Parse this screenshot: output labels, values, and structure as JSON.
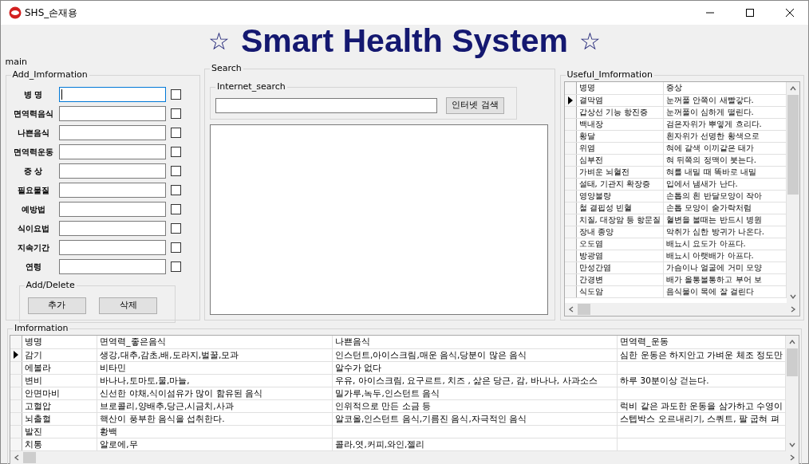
{
  "window": {
    "title": "SHS_손재용"
  },
  "header": {
    "left_star": "☆",
    "title": "Smart Health System",
    "right_star": "☆"
  },
  "main_label": "main",
  "add_information": {
    "title": "Add_Imformation",
    "fields": [
      {
        "label": "병 명",
        "focused": true,
        "checked": false
      },
      {
        "label": "면역력음식",
        "focused": false,
        "checked": false
      },
      {
        "label": "나쁜음식",
        "focused": false,
        "checked": false
      },
      {
        "label": "면역력운동",
        "focused": false,
        "checked": false
      },
      {
        "label": "증 상",
        "focused": false,
        "checked": false
      },
      {
        "label": "필요물질",
        "focused": false,
        "checked": false
      },
      {
        "label": "예방법",
        "focused": false,
        "checked": false
      },
      {
        "label": "식이요법",
        "focused": false,
        "checked": false
      },
      {
        "label": "지속기간",
        "focused": false,
        "checked": false
      },
      {
        "label": "연령",
        "focused": false,
        "checked": false
      }
    ],
    "add_delete": {
      "title": "Add/Delete",
      "buttons": [
        "추가",
        "삭제"
      ]
    }
  },
  "search": {
    "title": "Search",
    "internet_search": {
      "title": "Internet_search",
      "button": "인터넷 검색"
    }
  },
  "useful_information": {
    "title": "Useful_Imformation",
    "columns": [
      "병명",
      "증상"
    ],
    "rows": [
      {
        "cells": [
          "결막염",
          "눈꺼풀 안쪽이 새빨갛다."
        ],
        "selected": true
      },
      {
        "cells": [
          "갑상선 기능 항진증",
          "눈꺼풀이 심하게 떨린다."
        ],
        "selected": false
      },
      {
        "cells": [
          "백내장",
          "검은자위가 뿌옇게 흐리다."
        ],
        "selected": false
      },
      {
        "cells": [
          "황달",
          "흰자위가 선명한 황색으로"
        ],
        "selected": false
      },
      {
        "cells": [
          "위염",
          "혀에 갈색 이끼같은 태가"
        ],
        "selected": false
      },
      {
        "cells": [
          "심부전",
          "혀 뒤쪽의 정맥이 붓는다."
        ],
        "selected": false
      },
      {
        "cells": [
          "가벼운 뇌혈전",
          "혀를 내밀 때 똑바로 내밀"
        ],
        "selected": false
      },
      {
        "cells": [
          "설태, 기관지 확장증",
          "입에서 냄새가 난다."
        ],
        "selected": false
      },
      {
        "cells": [
          "영양불량",
          "손톱의 흰 반달모양이 작아"
        ],
        "selected": false
      },
      {
        "cells": [
          "철 결핍성 빈혈",
          "손톱 모양이 숟가락처럼"
        ],
        "selected": false
      },
      {
        "cells": [
          "치질, 대장암 등 항문질",
          "혈변을 볼때는 반드시 병원"
        ],
        "selected": false
      },
      {
        "cells": [
          "장내 종양",
          "악취가 심한 방귀가 나온다."
        ],
        "selected": false
      },
      {
        "cells": [
          "오도염",
          "배뇨시 요도가 아프다."
        ],
        "selected": false
      },
      {
        "cells": [
          "방광염",
          "배뇨시 아랫배가 아프다."
        ],
        "selected": false
      },
      {
        "cells": [
          "만성간염",
          "가슴이나 얼굴에 거미 모양"
        ],
        "selected": false
      },
      {
        "cells": [
          "간경변",
          "배가 올통볼통하고 부어 보"
        ],
        "selected": false
      },
      {
        "cells": [
          "식도암",
          "음식물이 목에 잘 걸린다"
        ],
        "selected": false
      }
    ]
  },
  "information": {
    "title": "Imformation",
    "columns": [
      "병명",
      "면역력_좋은음식",
      "나쁜음식",
      "면역력_운동"
    ],
    "rows": [
      {
        "cells": [
          "감기",
          "생강,대추,감초,배,도라지,벌꿀,모과",
          "인스턴트,아이스크림,매운 음식,당분이 많은 음식",
          "심한 운동은 하지안고 가벼운 체조 정도만"
        ],
        "selected": true
      },
      {
        "cells": [
          "에볼라",
          "비타민",
          "알수가 없다",
          ""
        ],
        "selected": false
      },
      {
        "cells": [
          "변비",
          "바나나,토마토,물,마늘,",
          "우유, 아이스크림, 요구르트, 치즈 , 삶은 당근, 감, 바나나, 사과소스",
          "하루 30분이상 걷는다."
        ],
        "selected": false
      },
      {
        "cells": [
          "안면마비",
          "신선한 야채,식이섬유가 많이 함유된 음식",
          "밀가루,녹두,인스턴트 음식",
          ""
        ],
        "selected": false
      },
      {
        "cells": [
          "고혈압",
          "브로콜리,양배추,당근,시금치,사과",
          "인위적으로 만든 소금 등",
          "럭비 같은 과도한 운동을 삼가하고 수영이"
        ],
        "selected": false
      },
      {
        "cells": [
          "뇌출혈",
          "핵산이 풍부한 음식을 섭취한다.",
          "알코올,인스턴트 음식,기름진 음식,자극적인 음식",
          "스텝박스 오르내리기, 스쿼트, 팔 굽혀 펴"
        ],
        "selected": false
      },
      {
        "cells": [
          "발진",
          "황백",
          "",
          ""
        ],
        "selected": false
      },
      {
        "cells": [
          "치통",
          "알로에,무",
          "콜라,엿,커피,와인,젤리",
          ""
        ],
        "selected": false
      }
    ]
  }
}
